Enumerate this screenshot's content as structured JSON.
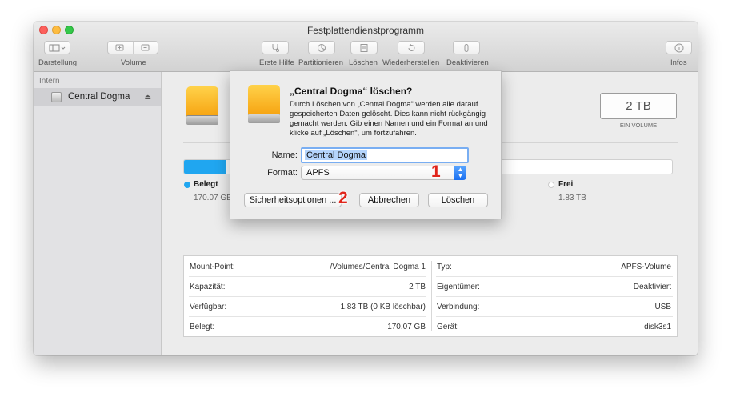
{
  "window": {
    "title": "Festplattendienstprogramm"
  },
  "toolbar": {
    "darstellung": "Darstellung",
    "volume": "Volume",
    "erste_hilfe": "Erste Hilfe",
    "partitionieren": "Partitionieren",
    "loeschen": "Löschen",
    "wiederherstellen": "Wiederherstellen",
    "deaktivieren": "Deaktivieren",
    "infos": "Infos"
  },
  "sidebar": {
    "section": "Intern",
    "item": "Central Dogma"
  },
  "disk": {
    "capacity": "2 TB",
    "capacity_label": "EIN VOLUME",
    "used_fraction": 0.085
  },
  "usage": {
    "used_label": "Belegt",
    "used_value": "170.07 GB",
    "used_color": "#20a6f0",
    "free_label": "Frei",
    "free_value": "1.83 TB"
  },
  "info": {
    "left": [
      {
        "key": "Mount-Point:",
        "value": "/Volumes/Central Dogma 1"
      },
      {
        "key": "Kapazität:",
        "value": "2 TB"
      },
      {
        "key": "Verfügbar:",
        "value": "1.83 TB (0 KB löschbar)"
      },
      {
        "key": "Belegt:",
        "value": "170.07 GB"
      }
    ],
    "right": [
      {
        "key": "Typ:",
        "value": "APFS-Volume"
      },
      {
        "key": "Eigentümer:",
        "value": "Deaktiviert"
      },
      {
        "key": "Verbindung:",
        "value": "USB"
      },
      {
        "key": "Gerät:",
        "value": "disk3s1"
      }
    ]
  },
  "dialog": {
    "title": "„Central Dogma“ löschen?",
    "message": "Durch Löschen von „Central Dogma“ werden alle darauf gespeicherten Daten gelöscht. Dies kann nicht rückgängig gemacht werden. Gib einen Namen und ein Format an und klicke auf „Löschen“, um fortzufahren.",
    "name_label": "Name:",
    "name_value": "Central Dogma",
    "format_label": "Format:",
    "format_value": "APFS",
    "security_button": "Sicherheitsoptionen ...",
    "cancel_button": "Abbrechen",
    "erase_button": "Löschen"
  },
  "annotations": {
    "one": "1",
    "two": "2"
  }
}
